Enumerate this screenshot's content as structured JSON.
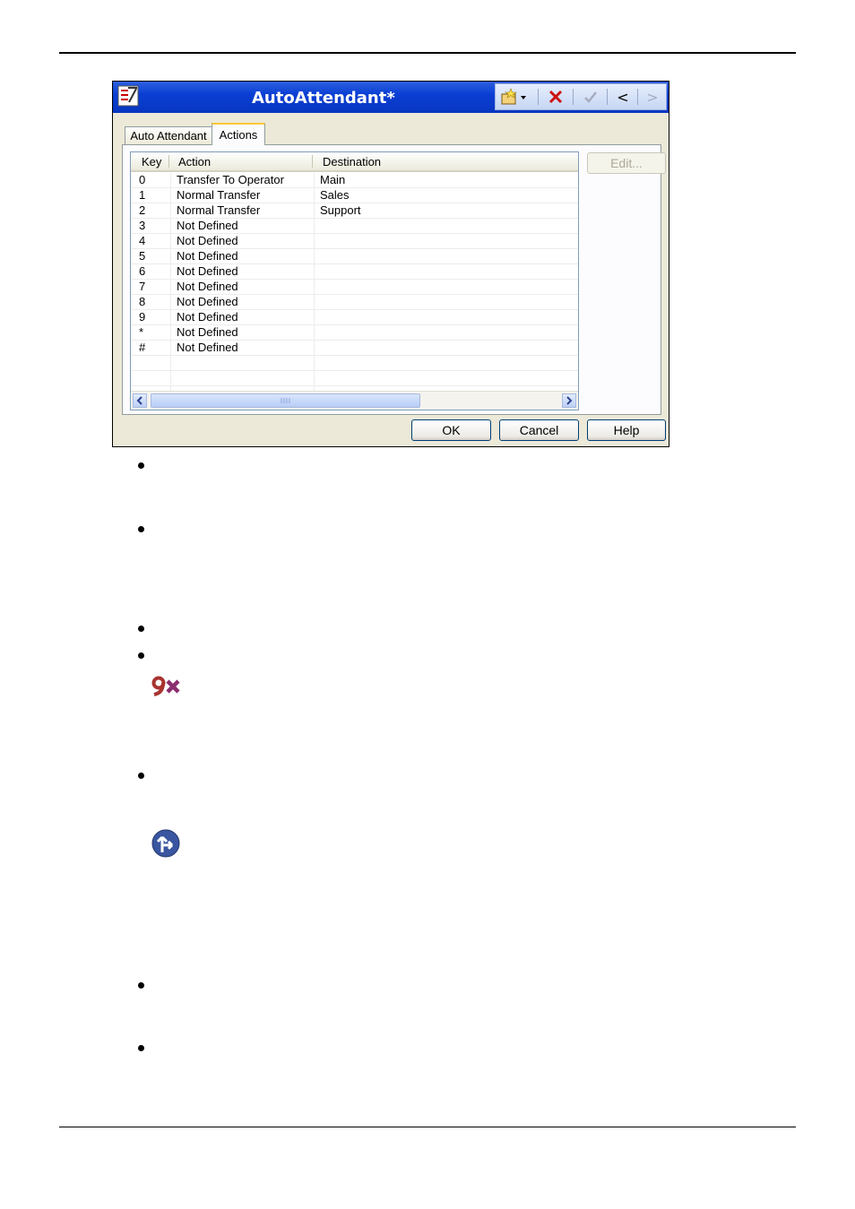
{
  "window": {
    "title": "AutoAttendant*"
  },
  "toolbar": {
    "new_icon": "new-item-icon",
    "delete_icon": "delete-icon",
    "apply_icon": "checkmark-icon",
    "prev_label": "<",
    "next_label": ">"
  },
  "tabs": [
    {
      "label": "Auto Attendant"
    },
    {
      "label": "Actions"
    }
  ],
  "table": {
    "columns": [
      "Key",
      "Action",
      "Destination"
    ],
    "rows": [
      {
        "key": "0",
        "action": "Transfer To Operator",
        "destination": "Main"
      },
      {
        "key": "1",
        "action": "Normal Transfer",
        "destination": "Sales"
      },
      {
        "key": "2",
        "action": "Normal Transfer",
        "destination": "Support"
      },
      {
        "key": "3",
        "action": "Not Defined",
        "destination": ""
      },
      {
        "key": "4",
        "action": "Not Defined",
        "destination": ""
      },
      {
        "key": "5",
        "action": "Not Defined",
        "destination": ""
      },
      {
        "key": "6",
        "action": "Not Defined",
        "destination": ""
      },
      {
        "key": "7",
        "action": "Not Defined",
        "destination": ""
      },
      {
        "key": "8",
        "action": "Not Defined",
        "destination": ""
      },
      {
        "key": "9",
        "action": "Not Defined",
        "destination": ""
      },
      {
        "key": "*",
        "action": "Not Defined",
        "destination": ""
      },
      {
        "key": "#",
        "action": "Not Defined",
        "destination": ""
      }
    ]
  },
  "buttons": {
    "edit": "Edit...",
    "ok": "OK",
    "cancel": "Cancel",
    "help": "Help"
  },
  "colors": {
    "titlebar": "#0a3fd4",
    "active_tab_accent": "#ffc83c",
    "delete_red": "#cc1111"
  }
}
